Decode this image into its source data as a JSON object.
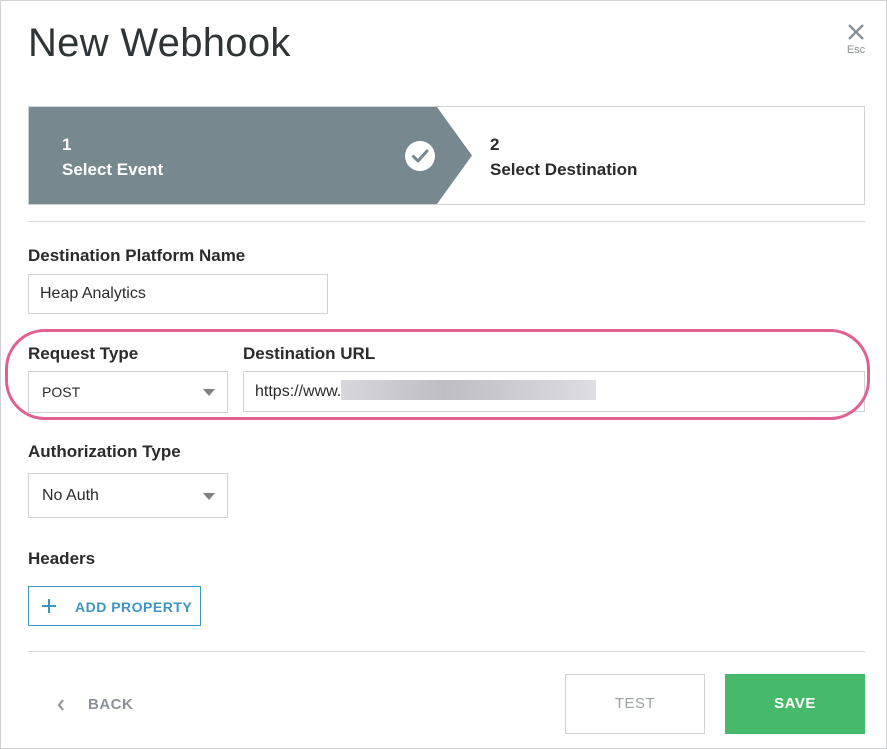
{
  "modal": {
    "title": "New Webhook",
    "close_hint": "Esc"
  },
  "stepper": {
    "steps": [
      {
        "number": "1",
        "label": "Select Event",
        "state": "completed"
      },
      {
        "number": "2",
        "label": "Select Destination",
        "state": "active"
      }
    ]
  },
  "form": {
    "destination_platform_name": {
      "label": "Destination Platform Name",
      "value": "Heap Analytics"
    },
    "request_type": {
      "label": "Request Type",
      "selected": "POST"
    },
    "destination_url": {
      "label": "Destination URL",
      "value": "https://www."
    },
    "authorization_type": {
      "label": "Authorization Type",
      "selected": "No Auth"
    },
    "headers": {
      "label": "Headers",
      "add_property_label": "ADD PROPERTY"
    }
  },
  "footer": {
    "back_label": "BACK",
    "test_label": "TEST",
    "save_label": "SAVE"
  },
  "colors": {
    "step_completed_bg": "#78888f",
    "accent_blue": "#3d95c4",
    "save_green": "#47b96a",
    "highlight_pink": "#e0608f"
  }
}
